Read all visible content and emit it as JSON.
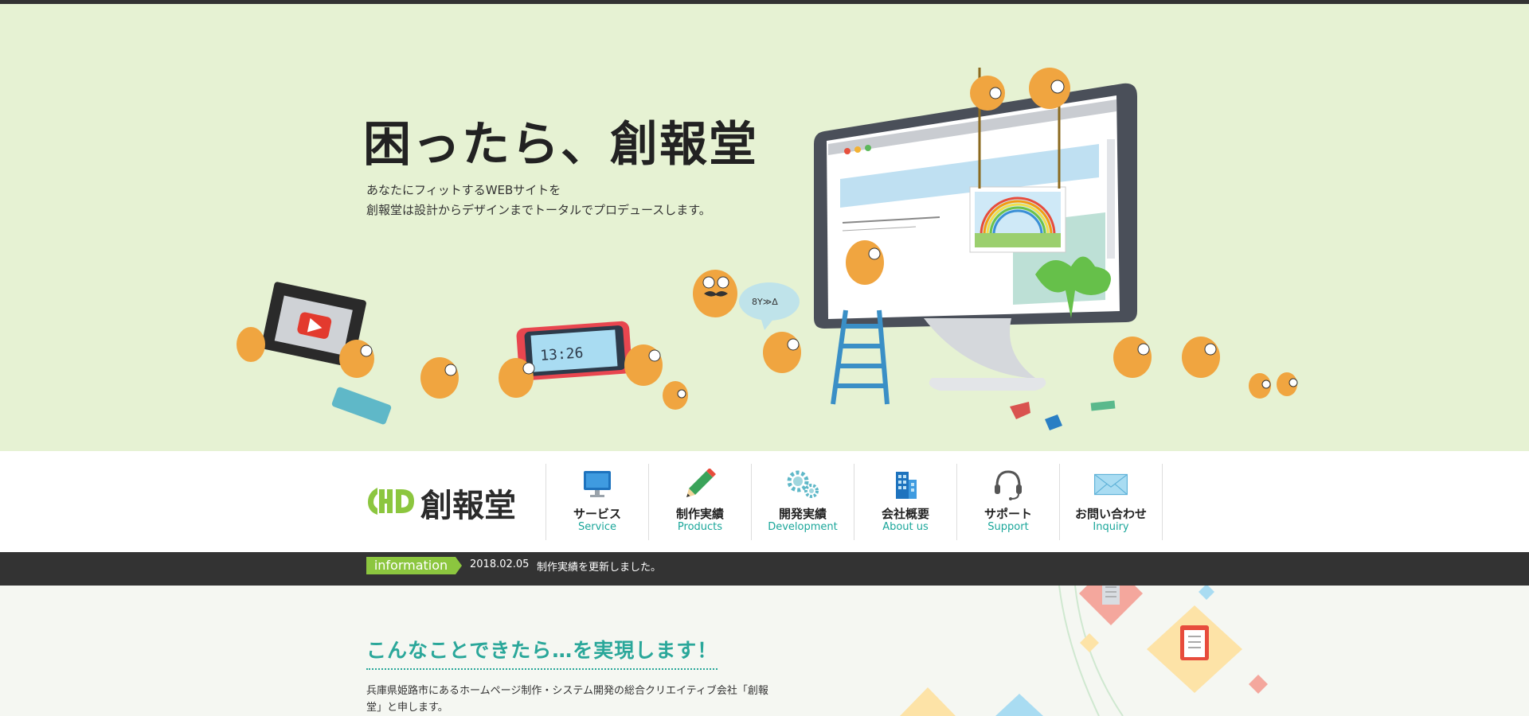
{
  "hero": {
    "title": "困ったら、創報堂",
    "description": [
      "あなたにフィットするWEBサイトを",
      "創報堂は設計からデザインまでトータルでプロデュースします。"
    ],
    "phone_clock": "13:26"
  },
  "logo": {
    "text": "創報堂"
  },
  "nav": {
    "items": [
      {
        "ja": "サービス",
        "en": "Service",
        "icon": "monitor-icon"
      },
      {
        "ja": "制作実績",
        "en": "Products",
        "icon": "pencil-icon"
      },
      {
        "ja": "開発実績",
        "en": "Development",
        "icon": "gears-icon"
      },
      {
        "ja": "会社概要",
        "en": "About us",
        "icon": "building-icon"
      },
      {
        "ja": "サポート",
        "en": "Support",
        "icon": "headset-icon"
      },
      {
        "ja": "お問い合わせ",
        "en": "Inquiry",
        "icon": "envelope-icon"
      }
    ]
  },
  "info": {
    "label": "information",
    "date": "2018.02.05",
    "message": "制作実績を更新しました。"
  },
  "section": {
    "title": "こんなことできたら…を実現します！",
    "body": "兵庫県姫路市にあるホームページ制作・システム開発の総合クリエイティブ会社「創報堂」と申します。"
  },
  "colors": {
    "hero_bg": "#e6f2d3",
    "accent_teal": "#1aa69a",
    "accent_green": "#8cc63f",
    "character_orange": "#f0a540",
    "infobar_bg": "#333333"
  }
}
